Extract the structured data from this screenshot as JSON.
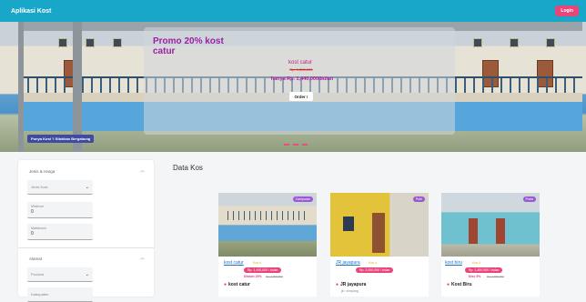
{
  "nav": {
    "brand": "Aplikasi Kost",
    "login": "Login"
  },
  "hero": {
    "promo_title": "Promo 20% kost catur",
    "kost_name": "kost catur",
    "old_price": "Rp. 1,800,000",
    "price": "hanya Rp. 1,440,000/bulan",
    "order_label": "Order !",
    "owner_label": "Punya Kost ? Silahkan Bergabung"
  },
  "sidebar": {
    "jenis_title": "Jenis & Harga",
    "jenis_placeholder": "Jenis Kost",
    "minimum_label": "Minimum",
    "minimum_value": "0",
    "maksimum_label": "Maksimum",
    "maksimum_value": "0",
    "alamat_title": "Alamat",
    "provinsi_placeholder": "Provinsi",
    "kabupaten_placeholder": "Kabupaten"
  },
  "main": {
    "title": "Data Kos",
    "cards": [
      {
        "badge": "Campuran",
        "name": "kost catur",
        "type": "Kos 4",
        "price": "Rp. 1,440,000 / bulan",
        "disc": "Diskon 20%",
        "old": "Rp. 1,800,000",
        "loc": "kost catur",
        "addr": ""
      },
      {
        "badge": "Putri",
        "name": "JR jayapura",
        "type": "Kos 4",
        "price": "Rp. 2,000,000 / bulan",
        "disc": "",
        "old": "",
        "loc": "JR jayapura",
        "addr": "jln. simpang"
      },
      {
        "badge": "Putra",
        "name": "kost biru",
        "type": "Kos 4",
        "price": "Rp. 1,400,000 / bulan",
        "disc": "Disc 5%",
        "old": "Rp. 1,500,000",
        "loc": "Kost Biru",
        "addr": ""
      }
    ]
  },
  "colors": {
    "nav": "#19a7c9",
    "accent": "#e8467b",
    "badge": "#9b59d0",
    "link": "#1a73c9"
  }
}
